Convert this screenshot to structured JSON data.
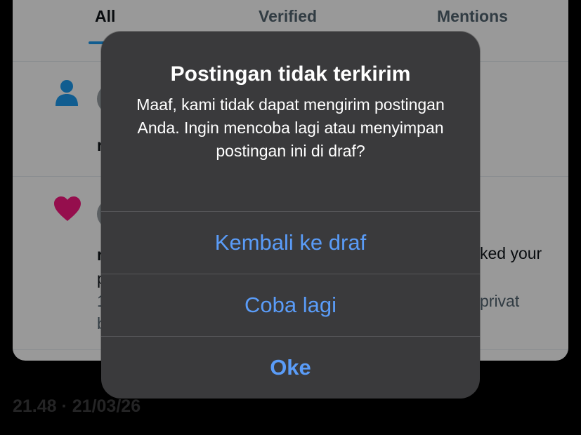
{
  "tabs": [
    {
      "label": "All",
      "active": true
    },
    {
      "label": "Verified",
      "active": false
    },
    {
      "label": "Mentions",
      "active": false
    }
  ],
  "notifications": [
    {
      "icon": "person-icon",
      "partial_text": "r"
    },
    {
      "icon": "heart-icon",
      "partial_line1": "r",
      "partial_right": "ked your",
      "partial_line2": "p",
      "partial_line3_left": "1",
      "partial_line3_right": "privat",
      "partial_line4": "b"
    }
  ],
  "timestamp": "21.48 · 21/03/26",
  "alert": {
    "title": "Postingan tidak terkirim",
    "message": "Maaf, kami tidak dapat mengirim postingan Anda. Ingin mencoba lagi atau menyimpan postingan ini di draf?",
    "buttons": {
      "back_to_drafts": "Kembali ke draf",
      "retry": "Coba lagi",
      "ok": "Oke"
    }
  },
  "colors": {
    "alert_bg": "#3a3a3c",
    "button_text": "#5a9cf8",
    "accent": "#1d9bf0",
    "heart": "#f91880"
  }
}
